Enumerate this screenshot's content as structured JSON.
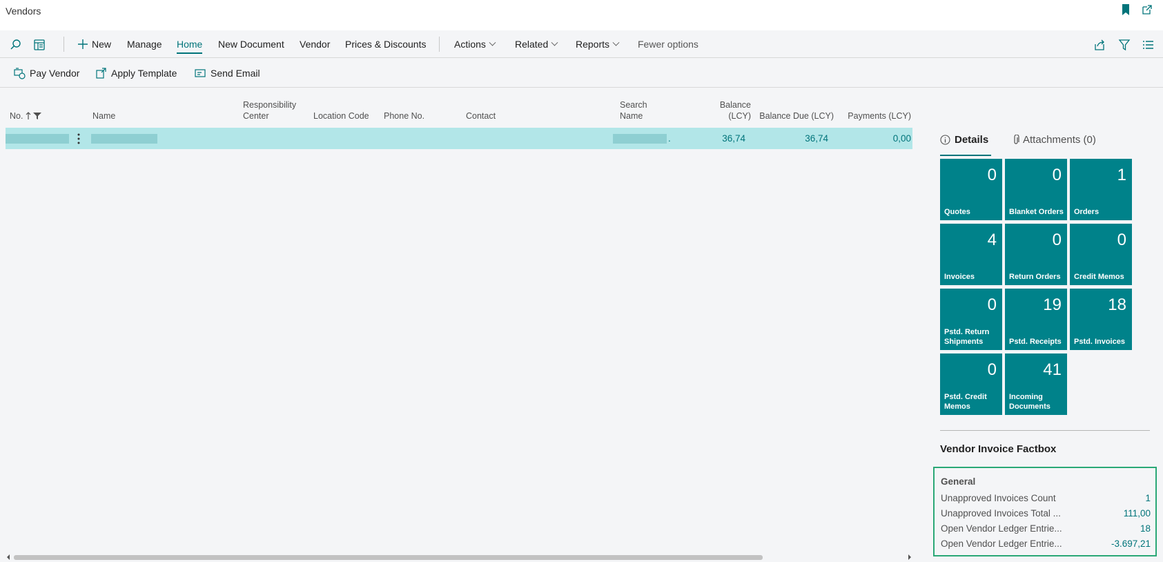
{
  "window": {
    "title": "Vendors"
  },
  "actions": {
    "new_label": "New",
    "manage_label": "Manage",
    "home_label": "Home",
    "new_document_label": "New Document",
    "vendor_label": "Vendor",
    "prices_label": "Prices & Discounts",
    "actions_label": "Actions",
    "related_label": "Related",
    "reports_label": "Reports",
    "fewer_label": "Fewer options"
  },
  "promoted": {
    "pay_vendor": "Pay Vendor",
    "apply_template": "Apply Template",
    "send_email": "Send Email"
  },
  "grid": {
    "headers": {
      "no": "No.",
      "name": "Name",
      "resp_1": "Responsibility",
      "resp_2": "Center",
      "location": "Location Code",
      "phone": "Phone No.",
      "contact": "Contact",
      "search_1": "Search",
      "search_2": "Name",
      "balance": "Balance (LCY)",
      "balance_due": "Balance Due (LCY)",
      "payments": "Payments (LCY)"
    },
    "row": {
      "search_suffix": ".",
      "balance": "36,74",
      "balance_due": "36,74",
      "payments": "0,00"
    }
  },
  "factbox": {
    "tab_details": "Details",
    "tab_attachments": "Attachments (0)",
    "tiles": [
      {
        "num": "0",
        "label": "Quotes"
      },
      {
        "num": "0",
        "label": "Blanket Orders"
      },
      {
        "num": "1",
        "label": "Orders"
      },
      {
        "num": "4",
        "label": "Invoices"
      },
      {
        "num": "0",
        "label": "Return Orders"
      },
      {
        "num": "0",
        "label": "Credit Memos"
      },
      {
        "num": "0",
        "label": "Pstd. Return Shipments"
      },
      {
        "num": "19",
        "label": "Pstd. Receipts"
      },
      {
        "num": "18",
        "label": "Pstd. Invoices"
      },
      {
        "num": "0",
        "label": "Pstd. Credit Memos"
      },
      {
        "num": "41",
        "label": "Incoming Documents"
      }
    ],
    "invoice_factbox_title": "Vendor Invoice Factbox",
    "general_label": "General",
    "rows": [
      {
        "key": "Unapproved Invoices Count",
        "value": "1"
      },
      {
        "key": "Unapproved Invoices Total ...",
        "value": "111,00"
      },
      {
        "key": "Open Vendor Ledger Entrie...",
        "value": "18"
      },
      {
        "key": "Open Vendor Ledger Entrie...",
        "value": "-3.697,21"
      }
    ]
  },
  "colors": {
    "accent": "#00747a",
    "tile": "#00828a",
    "selected_row": "#b2e6e8",
    "highlight_box": "#2aa876"
  }
}
